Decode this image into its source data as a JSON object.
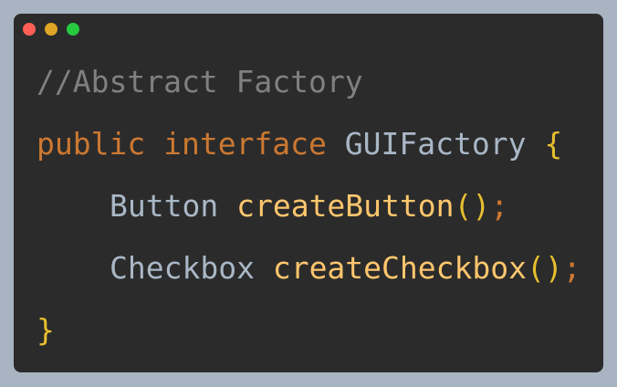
{
  "colors": {
    "background": "#a8b4c2",
    "editor_bg": "#2b2b2b",
    "comment": "#808080",
    "keyword": "#cc7832",
    "type": "#a9b7c6",
    "method": "#ffc66d",
    "punct": "#e8bf30",
    "close": "#ff5f56",
    "minimize": "#e0a526",
    "maximize": "#27c93f"
  },
  "window_controls": [
    "close-dot",
    "minimize-dot",
    "maximize-dot"
  ],
  "code": {
    "line1": {
      "comment": "//Abstract Factory"
    },
    "line2": {
      "kw_public": "public",
      "kw_interface": "interface",
      "name": "GUIFactory",
      "brace_open": "{"
    },
    "line3": {
      "type": "Button",
      "method": "createButton",
      "parens": "()",
      "semi": ";"
    },
    "line4": {
      "type": "Checkbox",
      "method": "createCheckbox",
      "parens": "()",
      "semi": ";"
    },
    "line5": {
      "brace_close": "}"
    }
  }
}
